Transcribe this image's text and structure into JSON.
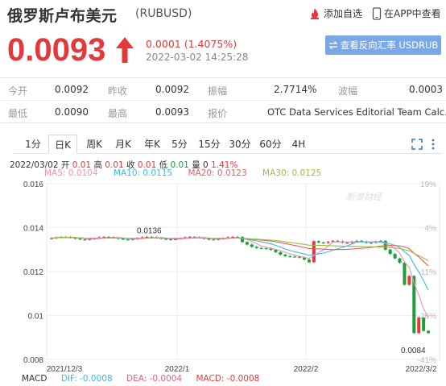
{
  "header": {
    "name": "俄罗斯卢布美元",
    "code": "(RUBUSD)",
    "add_watch": "添加自选",
    "app_view": "在APP中查看"
  },
  "quote": {
    "price": "0.0093",
    "change": "0.0001 (1.4075%)",
    "time": "2022-03-02 14:25:28",
    "reverse_button": "查看反向汇率 USDRUB"
  },
  "info": {
    "open_label": "今开",
    "open": "0.0092",
    "prev_label": "昨收",
    "prev": "0.0092",
    "amp_label": "振幅",
    "amp": "2.7714%",
    "wave_label": "波幅",
    "wave": "0.0003",
    "low_label": "最低",
    "low": "0.0090",
    "high_label": "最高",
    "high": "0.0093",
    "quote_label": "报价",
    "quote": "OTC Data Services Editorial Team Calc..."
  },
  "tabs": [
    "1分",
    "日K",
    "周K",
    "月K",
    "年K",
    "5分",
    "15分",
    "30分",
    "60分",
    "4H"
  ],
  "active_tab": "日K",
  "legend": {
    "date": "2022/03/02",
    "open_l": "开",
    "open": "0.01",
    "high_l": "高",
    "high": "0.01",
    "close_l": "收",
    "close": "0.01",
    "low_l": "低",
    "low": "0.01",
    "vol_l": "量",
    "vol": "0",
    "pct": "1.41%",
    "ma5": "MA5: 0.0104",
    "ma10": "MA10: 0.0115",
    "ma20": "MA20: 0.0123",
    "ma30": "MA30: 0.0125"
  },
  "macd": {
    "label": "MACD",
    "dif": "DIF: -0.0008",
    "dea": "DEA: -0.0004",
    "macd": "MACD: -0.0008"
  },
  "chart_data": {
    "type": "candlestick",
    "y_ticks": [
      "0.016",
      "0.014",
      "0.012",
      "0.01",
      "0.008"
    ],
    "ylim": [
      0.008,
      0.016
    ],
    "pct_ticks": [
      "19%",
      "4%",
      "-11%",
      "-26%",
      "-41%"
    ],
    "x_ticks": [
      "2021/12/3",
      "2022/1",
      "2022/2",
      "2022/3/2"
    ],
    "max_label": "0.0136",
    "min_label": "0.0084",
    "watermark": "新浪财经",
    "colors": {
      "up": "#e4393c",
      "down": "#1e9d3c",
      "ma5": "#f48fb1",
      "ma10": "#3fb9e0",
      "ma20": "#e06060",
      "ma30": "#9abd3c"
    }
  }
}
